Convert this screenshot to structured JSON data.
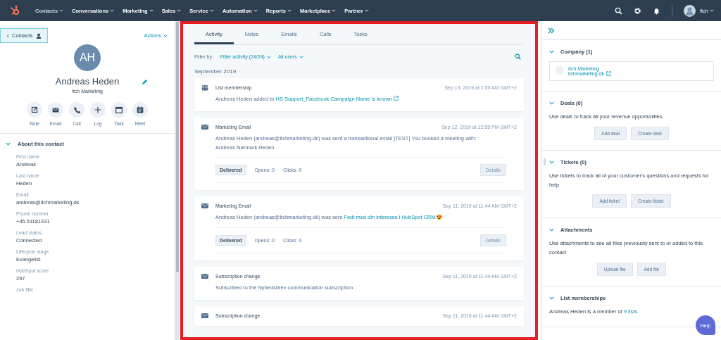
{
  "nav": {
    "items": [
      {
        "label": "Contacts",
        "selected": true
      },
      {
        "label": "Conversations",
        "selected": false
      },
      {
        "label": "Marketing",
        "selected": false
      },
      {
        "label": "Sales",
        "selected": false
      },
      {
        "label": "Service",
        "selected": false
      },
      {
        "label": "Automation",
        "selected": false
      },
      {
        "label": "Reports",
        "selected": false
      },
      {
        "label": "Marketplace",
        "selected": false
      },
      {
        "label": "Partner",
        "selected": false
      }
    ],
    "user": "Itch"
  },
  "contact": {
    "back": "Contacts",
    "actions": "Actions",
    "initials": "AH",
    "name": "Andreas Heden",
    "company": "Itch Marketing",
    "quick_actions": [
      {
        "label": "Note",
        "kind": "note"
      },
      {
        "label": "Email",
        "kind": "email"
      },
      {
        "label": "Call",
        "kind": "call"
      },
      {
        "label": "Log",
        "kind": "log"
      },
      {
        "label": "Task",
        "kind": "task"
      },
      {
        "label": "Meet",
        "kind": "meet"
      }
    ],
    "about": {
      "title": "About this contact",
      "expanded": true,
      "fields": [
        {
          "label": "First name",
          "value": "Andreas"
        },
        {
          "label": "Last name",
          "value": "Heden"
        },
        {
          "label": "Email",
          "value": "andreas@itchmarketing.dk"
        },
        {
          "label": "Phone number",
          "value": "+45 51181331"
        },
        {
          "label": "Lead status",
          "value": "Connected"
        },
        {
          "label": "Lifecycle stage",
          "value": "Evangelist"
        },
        {
          "label": "HubSpot score",
          "value": "297"
        },
        {
          "label": "Job title"
        }
      ]
    }
  },
  "activity": {
    "tabs": [
      {
        "label": "Activity",
        "selected": true
      },
      {
        "label": "Notes",
        "selected": false
      },
      {
        "label": "Emails",
        "selected": false
      },
      {
        "label": "Calls",
        "selected": false
      },
      {
        "label": "Tasks",
        "selected": false
      }
    ],
    "filter_label": "Filter by:",
    "filter_activity": "Filter activity (24/24)",
    "filter_users": "All users",
    "month": "September 2019",
    "items": [
      {
        "kind": "list",
        "title": "List membership",
        "time": "Sep 13, 2019 at 1:55 AM GMT+2",
        "text": "Andreas Heden added to ",
        "link": "HS Support_Facebook Campaign Name is known"
      },
      {
        "kind": "email",
        "title": "Marketing Email",
        "time": "Sep 12, 2019 at 12:55 PM GMT+2",
        "text": "Andreas Heden (andreas@itchmarketing.dk) was sent a transactional email [TEST] You booked a meeting with: Andreas Nørmark Heden",
        "status": "Delivered",
        "opens": "Opens: 0",
        "clicks": "Clicks: 0",
        "details": "Details"
      },
      {
        "kind": "email",
        "title": "Marketing Email",
        "time": "Sep 11, 2019 at 11:44 AM GMT+2",
        "text": "Andreas Heden (andreas@itchmarketing.dk) was sent ",
        "link": "Fedt med din interesse i HubSpot CRM😍",
        "status": "Delivered",
        "opens": "Opens: 0",
        "clicks": "Clicks: 0",
        "details": "Details"
      },
      {
        "kind": "subscription",
        "title": "Subscription change",
        "time": "Sep 11, 2019 at 11:44 AM GMT+2",
        "text": "Subscribed to the Nyhedsbrev communication subscription"
      },
      {
        "kind": "subscription",
        "title": "Subscription change",
        "time": "Sep 11, 2019 at 11:44 AM GMT+2"
      }
    ]
  },
  "sidebar": {
    "sections": [
      {
        "kind": "company",
        "title": "Company (1)",
        "expanded": true,
        "company_name": "Itch Marketing",
        "company_domain": "itchmarketing.dk"
      },
      {
        "kind": "text",
        "title": "Deals (0)",
        "expanded": true,
        "text": "Use deals to track all your revenue opportunities.",
        "buttons": [
          "Add deal",
          "Create deal"
        ]
      },
      {
        "kind": "text",
        "title": "Tickets (0)",
        "expanded": true,
        "text": "Use tickets to track all of your customer's questions and requests for help.",
        "buttons": [
          "Add ticket",
          "Create ticket"
        ]
      },
      {
        "kind": "text",
        "title": "Attachments",
        "expanded": true,
        "text": "Use attachments to see all files previously sent to or added to this contact",
        "buttons": [
          "Upload file",
          "Add file"
        ]
      },
      {
        "kind": "lists",
        "title": "List memberships",
        "expanded": true,
        "text": "Andreas Heden is a member of ",
        "link": "9 lists",
        "after": "."
      }
    ],
    "help": "Help"
  }
}
